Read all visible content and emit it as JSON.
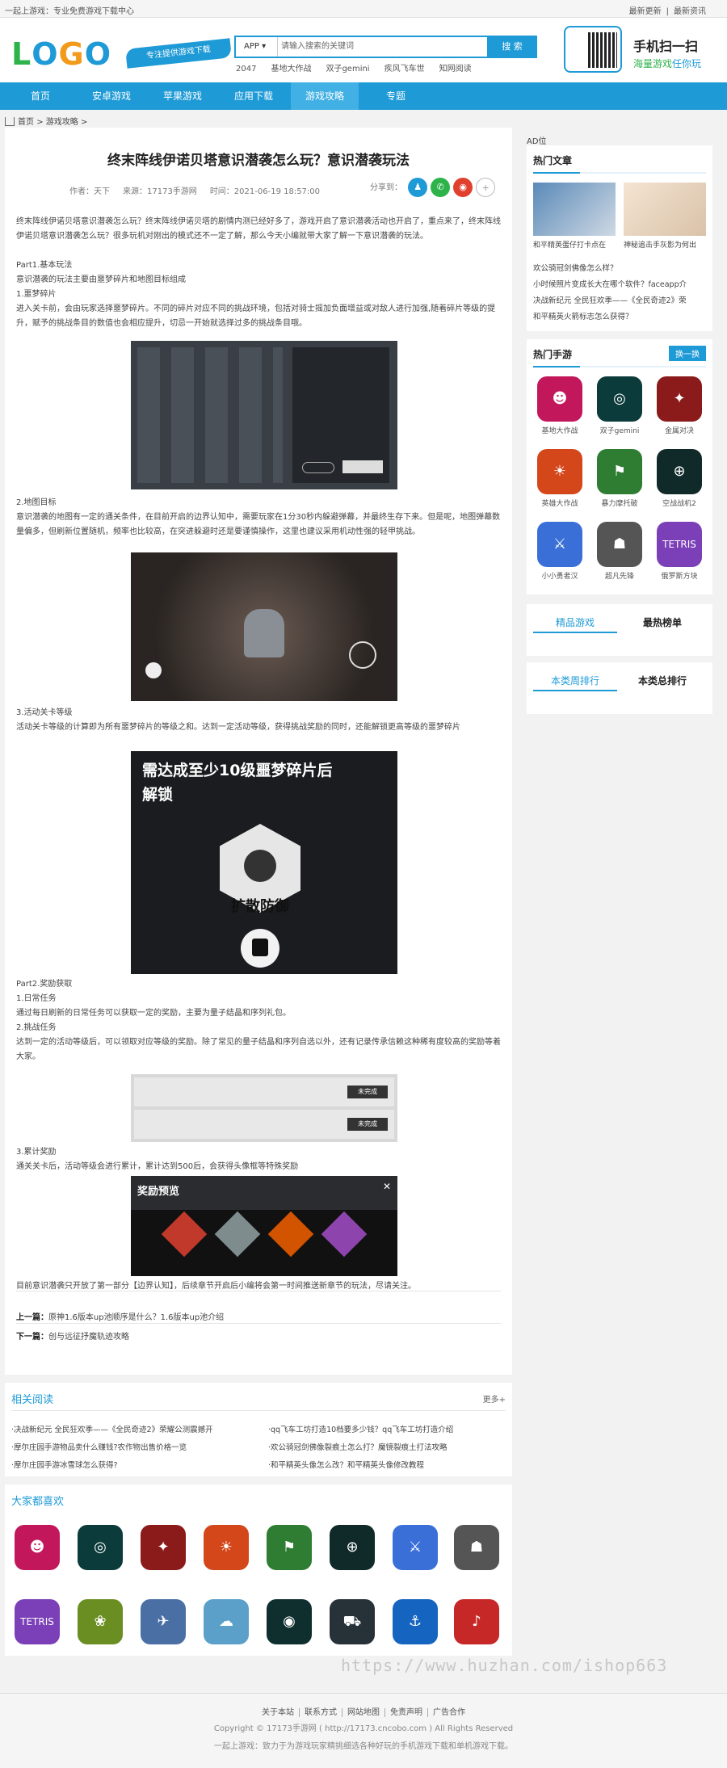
{
  "topbar": {
    "left": "一起上游戏：专业免费游戏下载中心",
    "right1": "最新更新",
    "right2": "最新资讯"
  },
  "logo": "LOGO",
  "slogan": "专注提供游戏下载",
  "search": {
    "select": "APP",
    "placeholder": "请输入搜索的关键词",
    "button": "搜 索"
  },
  "hotkw": [
    "2047",
    "基地大作战",
    "双子gemini",
    "疾风飞车世",
    "知网阅读"
  ],
  "qr": {
    "line1": "手机扫一扫",
    "line2a": "海量游戏",
    "line2b": "任你玩"
  },
  "nav": [
    "首页",
    "安卓游戏",
    "苹果游戏",
    "应用下载",
    "游戏攻略",
    "专题"
  ],
  "crumb": {
    "home": "首页",
    "sep": ">",
    "section": "游戏攻略",
    "tail": ">"
  },
  "article": {
    "title": "终末阵线伊诺贝塔意识潜袭怎么玩？意识潜袭玩法",
    "author": "作者：天下",
    "source": "来源：17173手游网",
    "time": "时间：2021-06-19 18:57:00",
    "share": "分享到：",
    "p1": "终末阵线伊诺贝塔意识潜袭怎么玩？终末阵线伊诺贝塔的剧情内测已经好多了，游戏开启了意识潜袭活动也开启了，重点来了，终末阵线伊诺贝塔意识潜袭怎么玩？很多玩机对刚出的模式还不一定了解，那么今天小编就带大家了解一下意识潜袭的玩法。",
    "h1": "Part1.基本玩法",
    "p2": "意识潜袭的玩法主要由噩梦碎片和地图目标组成",
    "h2": "1.噩梦碎片",
    "p3": "进入关卡前，会由玩家选择噩梦碎片。不同的碎片对应不同的挑战环境，包括对骑士摇加负面增益或对敌人进行加强,随着碎片等级的提升，赋予的挑战条目的数值也会相应提升，切忌一开始就选择过多的挑战条目哦。",
    "h3": "2.地图目标",
    "p4": "意识潜袭的地图有一定的通关条件，在目前开启的边界认知中，需要玩家在1分30秒内躲避弹幕，并最终生存下来。但是呢，地图弹幕数量偏多，但刷新位置随机，频率也比较高，在突进躲避时还是要谨慎操作，这里也建议采用机动性强的轻甲挑战。",
    "h4": "3.活动关卡等级",
    "p5": "活动关卡等级的计算即为所有噩梦碎片的等级之和。达到一定活动等级，获得挑战奖励的同时，还能解锁更高等级的噩梦碎片",
    "img3a": "需达成至少10级噩梦碎片后",
    "img3b": "解锁",
    "img3c": "扩散防御",
    "h5": "Part2.奖励获取",
    "h6": "1.日常任务",
    "p6": "通过每日刷新的日常任务可以获取一定的奖励，主要为量子结晶和序列礼包。",
    "h7": "2.挑战任务",
    "p7": "达到一定的活动等级后，可以领取对应等级的奖励。除了常见的量子结晶和序列自选以外，还有记录传承信赖这种稀有度较高的奖励等着大家。",
    "img4a": "未完成",
    "img4b": "未完成",
    "h8": "3.累计奖励",
    "p8": "通关关卡后，活动等级会进行累计，累计达到500后，会获得头像框等特殊奖励",
    "img5": "奖励预览",
    "p9": "目前意识潜袭只开放了第一部分【边界认知】，后续章节开启后小编将会第一时间推送新章节的玩法，尽请关注。",
    "prev_label": "上一篇：",
    "prev": "原神1.6版本up池顺序是什么？1.6版本up池介绍",
    "next_label": "下一篇：",
    "next": "创与远征抒魔轨迹攻略"
  },
  "sidebar": {
    "ad": "AD位",
    "hot_articles": "热门文章",
    "thumb1": "和平精英蛋仔打卡点在",
    "thumb2": "神秘追击手灰影为何出",
    "list": [
      "欢公骑冠剑佛像怎么样？",
      "小时候照片变成长大在哪个软件？faceapp介",
      "决战新纪元 全民狂欢季——《全民奇迹2》荣",
      "和平精英火箭标志怎么获得？"
    ],
    "hot_games": "热门手游",
    "swap": "换一换",
    "games": [
      "基地大作战",
      "双子gemini",
      "金属对决",
      "英雄大作战",
      "暴力摩托破",
      "空战战机2",
      "小小勇者汉",
      "超凡先锋",
      "俄罗斯方块"
    ],
    "tabs1": [
      "精品游戏",
      "最热榜单"
    ],
    "tabs2": [
      "本类周排行",
      "本类总排行"
    ]
  },
  "related": {
    "title": "相关阅读",
    "more": "更多+",
    "items": [
      "·决战新纪元 全民狂欢季——《全民奇迹2》荣耀公测震撼开",
      "·qq飞车工坊打造10档要多少钱？qq飞车工坊打造介绍",
      "·摩尔庄园手游物品卖什么赚钱?农作物出售价格一览",
      "·欢公骑冠剑佛像裂痕土怎么打？魔镜裂痕土打法攻略",
      "·摩尔庄园手游冰雪球怎么获得?",
      "·和平精英头像怎么改？和平精英头像修改教程"
    ]
  },
  "like": {
    "title": "大家都喜欢"
  },
  "footer": {
    "links": [
      "关于本站",
      "联系方式",
      "网站地图",
      "免责声明",
      "广告合作"
    ],
    "copy": "Copyright © 17173手游网 ( http://17173.cncobo.com ) All Rights Reserved",
    "desc": "一起上游戏：致力于为游戏玩家精挑细选各种好玩的手机游戏下载和单机游戏下载。"
  },
  "watermark": "https://www.huzhan.com/ishop663",
  "colors": {
    "accent": "#1e9ad6",
    "nav": "#1e9ad6"
  }
}
